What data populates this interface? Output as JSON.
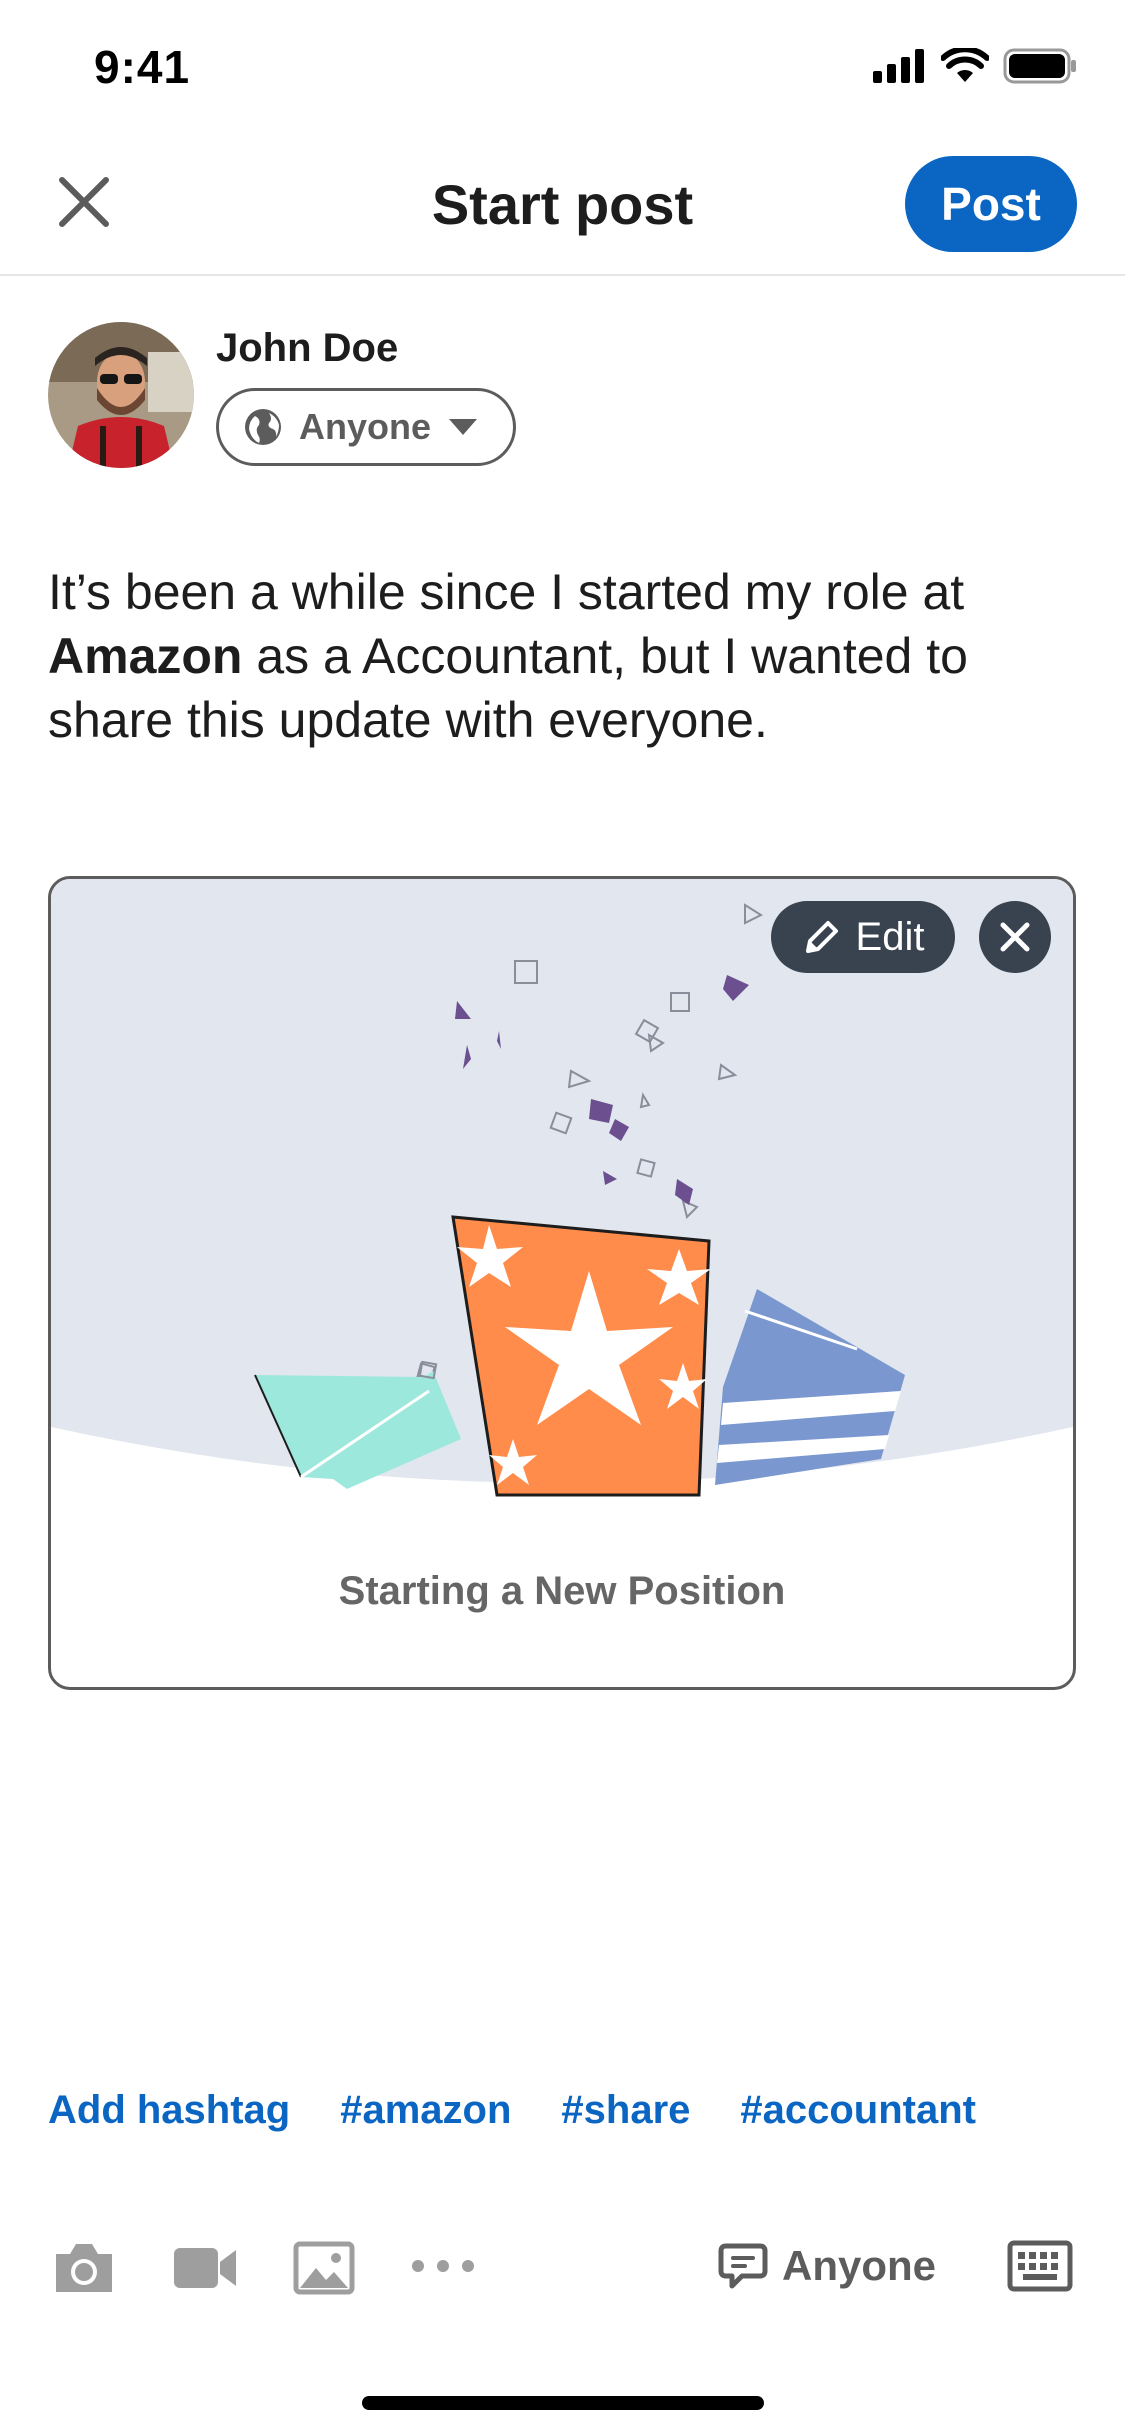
{
  "status_bar": {
    "time": "9:41"
  },
  "nav": {
    "title": "Start post",
    "post_label": "Post"
  },
  "author": {
    "name": "John Doe",
    "audience": "Anyone"
  },
  "post": {
    "text_before": "It’s been a while since I started my role at ",
    "company": "Amazon",
    "text_after": " as a Accountant, but I wanted to share this update with everyone."
  },
  "card": {
    "edit_label": "Edit",
    "caption": "Starting a New Position"
  },
  "hashtags": [
    "Add hashtag",
    "#amazon",
    "#share",
    "#accountant"
  ],
  "toolbar": {
    "comment_audience": "Anyone"
  },
  "colors": {
    "accent": "#0a66c2",
    "dark_button": "#38434f",
    "art_background": "#e1e6ef"
  },
  "icons": [
    "signal-icon",
    "wifi-icon",
    "battery-icon",
    "close-icon",
    "globe-icon",
    "caret-down-icon",
    "pencil-icon",
    "remove-icon",
    "camera-icon",
    "video-icon",
    "image-icon",
    "more-icon",
    "comment-icon",
    "keyboard-icon"
  ]
}
